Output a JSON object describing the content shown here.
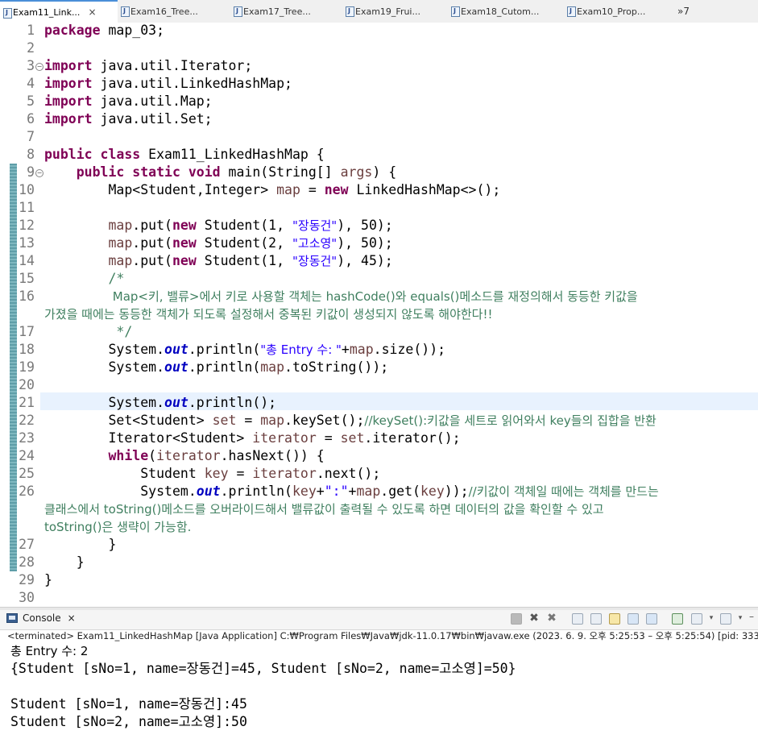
{
  "tabs": [
    {
      "label": "Exam11_Link...",
      "active": true,
      "close": "×"
    },
    {
      "label": "Exam16_Tree..."
    },
    {
      "label": "Exam17_Tree..."
    },
    {
      "label": "Exam19_Frui..."
    },
    {
      "label": "Exam18_Cutom..."
    },
    {
      "label": "Exam10_Prop..."
    }
  ],
  "tab_overflow": "»7",
  "line_numbers": [
    "1",
    "2",
    "3",
    "4",
    "5",
    "6",
    "7",
    "8",
    "9",
    "10",
    "11",
    "12",
    "13",
    "14",
    "15",
    "16",
    "17",
    "18",
    "19",
    "20",
    "21",
    "22",
    "23",
    "24",
    "25",
    "26",
    "27",
    "28",
    "29",
    "30"
  ],
  "code": {
    "l1_kw": "package",
    "l1": " map_03;",
    "l3_kw": "import",
    "l3": " java.util.Iterator;",
    "l4_kw": "import",
    "l4": " java.util.LinkedHashMap;",
    "l5_kw": "import",
    "l5": " java.util.Map;",
    "l6_kw": "import",
    "l6": " java.util.Set;",
    "l8_kw1": "public",
    "l8_kw2": "class",
    "l8": " Exam11_LinkedHashMap {",
    "l9_kw1": "public",
    "l9_kw2": "static",
    "l9_kw3": "void",
    "l9_a": " main(String[] ",
    "l9_var": "args",
    "l9_b": ") {",
    "l10_a": "Map<Student,Integer> ",
    "l10_var": "map",
    "l10_b": " = ",
    "l10_kw": "new",
    "l10_c": " LinkedHashMap<>();",
    "l12_var": "map",
    "l12_a": ".put(",
    "l12_kw": "new",
    "l12_b": " Student(1, ",
    "l12_str": "\"장동건\"",
    "l12_c": "), 50);",
    "l13_var": "map",
    "l13_a": ".put(",
    "l13_kw": "new",
    "l13_b": " Student(2, ",
    "l13_str": "\"고소영\"",
    "l13_c": "), 50);",
    "l14_var": "map",
    "l14_a": ".put(",
    "l14_kw": "new",
    "l14_b": " Student(1, ",
    "l14_str": "\"장동건\"",
    "l14_c": "), 45);",
    "l15": "/*",
    "l16": " Map<키, 밸류>에서 키로 사용할 객체는 hashCode()와 equals()메소드를 재정의해서 동등한 키값을",
    "l16w": "가졌을 때에는 동등한 객체가 되도록 설정해서 중복된 키값이 생성되지 않도록 해야한다!!",
    "l17": " */",
    "l18_a": "System.",
    "l18_fld": "out",
    "l18_b": ".println(",
    "l18_str": "\"총 Entry 수: \"",
    "l18_c": "+",
    "l18_var": "map",
    "l18_d": ".size());",
    "l19_a": "System.",
    "l19_fld": "out",
    "l19_b": ".println(",
    "l19_var": "map",
    "l19_c": ".toString());",
    "l21_a": "System.",
    "l21_fld": "out",
    "l21_b": ".println();",
    "l22_a": "Set<Student> ",
    "l22_var": "set",
    "l22_b": " = ",
    "l22_var2": "map",
    "l22_c": ".keySet();",
    "l22_cm": "//keySet():키값을 세트로 읽어와서 key들의 집합을 반환",
    "l23_a": "Iterator<Student> ",
    "l23_var": "iterator",
    "l23_b": " = ",
    "l23_var2": "set",
    "l23_c": ".iterator();",
    "l24_kw": "while",
    "l24_a": "(",
    "l24_var": "iterator",
    "l24_b": ".hasNext()) {",
    "l25_a": "Student ",
    "l25_var": "key",
    "l25_b": " = ",
    "l25_var2": "iterator",
    "l25_c": ".next();",
    "l26_a": "System.",
    "l26_fld": "out",
    "l26_b": ".println(",
    "l26_var": "key",
    "l26_c": "+",
    "l26_str": "\":\"",
    "l26_d": "+",
    "l26_var2": "map",
    "l26_e": ".get(",
    "l26_var3": "key",
    "l26_f": "));",
    "l26_cm": "//키값이 객체일 때에는 객체를 만드는",
    "l26w1": "클래스에서 toString()메소드를 오버라이드해서 밸류값이 출력될 수 있도록 하면 데이터의 값을 확인할 수 있고",
    "l26w2": "toString()은 생략이 가능함.",
    "l27": "}",
    "l28": "}",
    "l29": "}"
  },
  "console": {
    "tab_label": "Console",
    "tab_close": "×",
    "status": "<terminated> Exam11_LinkedHashMap [Java Application] C:₩Program Files₩Java₩jdk-11.0.17₩bin₩javaw.exe  (2023. 6. 9. 오후 5:25:53 – 오후 5:25:54) [pid: 33320]",
    "output": [
      "총 Entry 수: 2",
      "{Student [sNo=1, name=장동건]=45, Student [sNo=2, name=고소영]=50}",
      "",
      "Student [sNo=1, name=장동건]:45",
      "Student [sNo=2, name=고소영]:50"
    ]
  },
  "colors": {
    "keyword": "#7f0055",
    "string": "#2a00ff",
    "comment": "#3f7f5f",
    "field": "#0000c0",
    "local_var": "#6a3e3e"
  },
  "icons": [
    "java-file-icon",
    "close-icon",
    "console-icon",
    "terminate-icon",
    "remove-launch-icon",
    "clear-console-icon",
    "scroll-lock-icon",
    "pin-console-icon",
    "open-console-icon"
  ]
}
